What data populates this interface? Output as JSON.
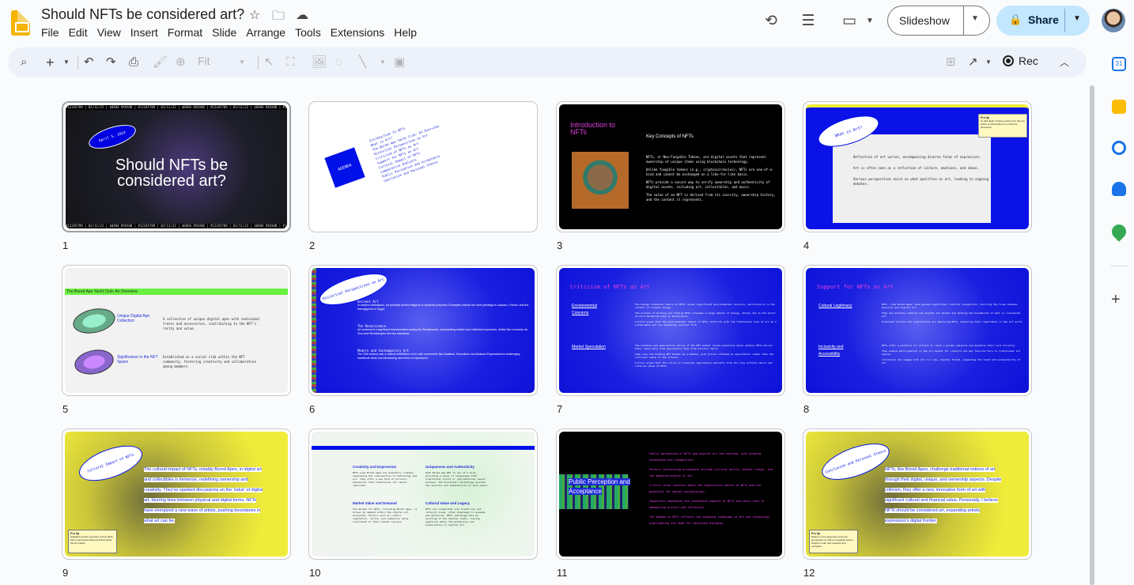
{
  "doc": {
    "title": "Should NFTs be considered art?"
  },
  "menu": [
    "File",
    "Edit",
    "View",
    "Insert",
    "Format",
    "Slide",
    "Arrange",
    "Tools",
    "Extensions",
    "Help"
  ],
  "buttons": {
    "slideshow": "Slideshow",
    "share": "Share",
    "rec": "Rec",
    "zoom": "Fit"
  },
  "colors": {
    "accent": "#c2e7ff",
    "toolbar": "#edf2fa"
  },
  "slides": [
    {
      "num": "1",
      "date": "April 5, 2024",
      "title": "Should NFTs be considered art?",
      "ticker": "#12345789 | 02/11/22 | $0XH4 #XXXAB | #12345789 | 02/11/22 | $0XH4 #XXXAB | #12345789 | 02/11/22 | $0XH4 #XXXAB | #12345789"
    },
    {
      "num": "2",
      "label": "AGENDA",
      "items": [
        "Introduction to NFTs",
        "What is Art?",
        "The Bored Ape Yacht Club: An Overview",
        "Historical Perspectives on Art",
        "Criticism of NFTs as Art",
        "Support for NFTs as Art",
        "Cultural Impact of NFTs",
        "Comparative Analysis",
        "Public Perception and Acceptance",
        "Conclusion and Personal Stance"
      ]
    },
    {
      "num": "3",
      "heading": "Introduction to NFTs",
      "sub": "Key Concepts of NFTs",
      "bullets": [
        "NFTs, or Non-Fungible Tokens, are digital assets that represent ownership of unique items using blockchain technology.",
        "Unlike fungible tokens (e.g., cryptocurrencies), NFTs are one-of-a-kind and cannot be exchanged on a like-for-like basis.",
        "NFTs provide a secure way to verify ownership and authenticity of digital assets, including art, collectibles, and music.",
        "The value of an NFT is derived from its scarcity, ownership history, and the content it represents."
      ]
    },
    {
      "num": "4",
      "oval": "What is Art?",
      "tip_title": "Pro tip",
      "tip": "To add depth, include quotes from famous artists or philosophers to enrich the discussion.",
      "bullets": [
        "Definition of art varies, encompassing diverse forms of expression.",
        "Art is often seen as a reflection of culture, emotions, and ideas.",
        "Various perspectives exist on what qualifies as art, leading to ongoing debates."
      ]
    },
    {
      "num": "5",
      "heading": "The Bored Ape Yacht Club: An Overview",
      "rows": [
        {
          "label": "Unique Digital Ape Collection",
          "text": "A collection of unique digital apes with individual traits and accessories, contributing to the NFT's rarity and value."
        },
        {
          "label": "Significance in the NFT Space",
          "text": "Established as a social club within the NFT community, fostering creativity and collaboration among members."
        }
      ]
    },
    {
      "num": "6",
      "oval": "Historical Perspectives on Art",
      "sections": [
        {
          "h": "Ancient Art",
          "t": "In ancient civilizations, art primarily served religious or symbolic purposes. Examples include the cave paintings in Lascaux, France, and the hieroglyphics in Egypt."
        },
        {
          "h": "The Renaissance",
          "t": "Art underwent a significant transformation during the Renaissance, emphasizing realism and individual expression. Artists like Leonardo da Vinci and Michelangelo set new standards."
        },
        {
          "h": "Modern and Contemporary Art",
          "t": "The 20th century saw a radical redefinition of art, with movements like Dadaism, Surrealism, and Abstract Expressionism challenging traditional views and introducing new forms of expression."
        }
      ]
    },
    {
      "num": "7",
      "heading": "Criticism of NFTs as Art",
      "groups": [
        {
          "label": "Environmental Concerns",
          "bullets": [
            "The energy-intensive nature of NFTs raises significant environmental concerns, particularly in the context of climate change.",
            "The process of minting and trading NFTs consumes a large amount of energy, mainly due to the proof-of-work mechanism used in blockchains.",
            "Critics argue that the environmental impact of NFTs conflicts with the traditional view of art as a sustainable and non-depleting cultural form."
          ]
        },
        {
          "label": "Market Speculation",
          "bullets": [
            "The volatile and speculative nature of the NFT market raises questions about whether NFTs derive their value more from speculation than from artistic merit.",
            "Some view the booming NFT market as a bubble, with prices inflated by speculation rather than the intrinsic value of the artwork.",
            "Critics argue that this focus on financial speculation detracts from the true artistic merit and cultural value of NFTs."
          ]
        }
      ]
    },
    {
      "num": "8",
      "heading": "Support for NFTs as Art",
      "groups": [
        {
          "label": "Cultural Legitimacy",
          "bullets": [
            "NFTs, like Bored Apes, have gained significant cultural recognition, blurring the lines between physical and digital art.",
            "They are actively shaping the digital art market and pushing the boundaries of what is considered art.",
            "Prominent artists and institutions are embracing NFTs, enhancing their legitimacy in the art world."
          ]
        },
        {
          "label": "Inclusivity and Accessibility",
          "bullets": [
            "NFTs offer a platform for artists to reach a global audience and monetize their work directly.",
            "They enable participation in the art market for creators who may face barriers in traditional art spaces.",
            "Collectors can engage with art in a new, digital format, expanding the reach and accessibility of art."
          ]
        }
      ]
    },
    {
      "num": "9",
      "oval": "Cultural Impact of NFTs",
      "text": "The cultural impact of NFTs, notably Bored Apes, in digital art and collectibles is immense, redefining ownership and creativity. They've sparked discussions on the 'value' of digital art, blurring lines between physical and digital forms. NFTs have energized a new wave of artists, pushing boundaries in what art can be.",
      "tip_title": "Pro tip",
      "tip": "Highlight specific examples of how NFTs have empowered artists and diversified the art market."
    },
    {
      "num": "10",
      "cols": [
        {
          "h": "Creativity and Expression",
          "t": "NFTs like Bored Apes are digitally created, showcasing the intersection of technology and art. They offer a new form of artistic expression that traditional art cannot replicate."
        },
        {
          "h": "Uniqueness and Authenticity",
          "t": "Each Bored Ape NFT is one of a kind, providing a level of uniqueness that traditional prints or reproductions cannot achieve. The blockchain technology ensures the security and authenticity of each piece."
        },
        {
          "h": "Market Value and Demand",
          "t": "The market for NFTs, including Bored Apes, is driven by demand within the digital art ecosystem. Factors such as creator reputation, rarity, and community value contribute to their market success."
        },
        {
          "h": "Cultural Value and Legacy",
          "t": "NFTs are integrated into historical and cultural views, often displayed in museums and galleries. NFTs challenge this by existing in the digital realm, raising questions about the permanence and preservation of digital art."
        }
      ]
    },
    {
      "num": "11",
      "heading": "Public Perception and Acceptance",
      "bullets": [
        "Public perception of NFTs and digital art has evolved, with growing acceptance and recognition.",
        "Factors influencing acceptance include cultural shifts, market trends, and the democratization of art.",
        "Critics raise concerns about the speculative nature of NFTs and the potential for market manipulation.",
        "Supporters emphasize the innovative aspects of NFTs and their role in empowering artists and collectors.",
        "The debate on NFTs reflects the changing landscape of art and technology, highlighting the need for continued dialogue."
      ]
    },
    {
      "num": "12",
      "oval": "Conclusion and Personal Stance",
      "text": "NFTs, like Bored Apes, challenge traditional notions of art through their digital, unique, and ownership aspects. Despite criticism, they offer a new, innovative form of art with significant cultural and financial value. Personally, I believe NFTs should be considered art, expanding artistic expression's digital frontier.",
      "tip_title": "Pro tip",
      "tip": "Reflect on the arguments and your perspective to craft a compelling stance. Support it with new research and examples."
    }
  ]
}
